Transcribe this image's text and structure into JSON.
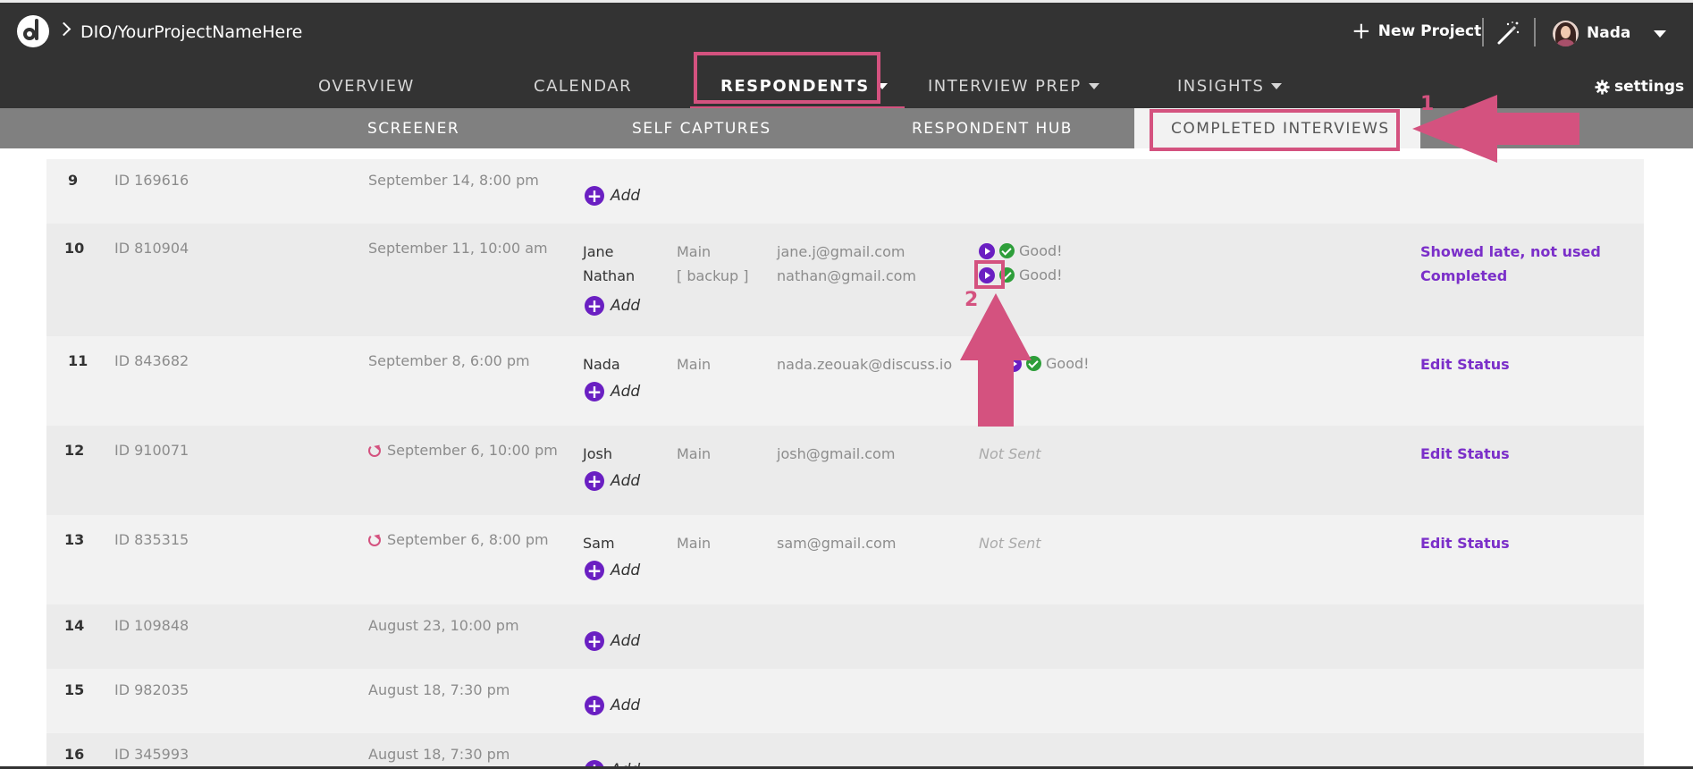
{
  "app": {
    "breadcrumb": "DIO/YourProjectNameHere",
    "new_project_label": "New Project",
    "user_name": "Nada",
    "settings_label": "settings"
  },
  "nav": {
    "tabs": [
      {
        "label": "OVERVIEW"
      },
      {
        "label": "CALENDAR"
      },
      {
        "label": "RESPONDENTS",
        "active": true
      },
      {
        "label": "INTERVIEW PREP"
      },
      {
        "label": "INSIGHTS"
      }
    ]
  },
  "subnav": {
    "tabs": [
      {
        "label": "SCREENER"
      },
      {
        "label": "SELF CAPTURES"
      },
      {
        "label": "RESPONDENT HUB"
      },
      {
        "label": "COMPLETED INTERVIEWS",
        "active": true
      }
    ]
  },
  "annotations": {
    "step1": "1",
    "step2": "2",
    "color": "#d4527f"
  },
  "colors": {
    "topbar": "#333333",
    "subbar": "#808080",
    "accent_purple": "#7b2fc9",
    "status_green": "#2e9e3a",
    "highlight_pink": "#d4527f"
  },
  "add_label": "Add",
  "rows": [
    {
      "num": "9",
      "id": "ID 169616",
      "date": "September 14, 8:00 pm"
    },
    {
      "num": "10",
      "id": "ID 810904",
      "date": "September 11, 10:00 am",
      "people": [
        {
          "name": "Jane",
          "role": "Main",
          "email": "jane.j@gmail.com",
          "status": "Good!",
          "action": "Showed late, not used"
        },
        {
          "name": "Nathan",
          "role": "[ backup ]",
          "email": "nathan@gmail.com",
          "status": "Good!",
          "action": "Completed"
        }
      ]
    },
    {
      "num": "11",
      "id": "ID 843682",
      "date": "September 8, 6:00 pm",
      "people": [
        {
          "name": "Nada",
          "role": "Main",
          "email": "nada.zeouak@discuss.io",
          "status": "Good!",
          "action": "Edit Status"
        }
      ]
    },
    {
      "num": "12",
      "id": "ID 910071",
      "date": "September 6, 10:00 pm",
      "rescheduled": true,
      "people": [
        {
          "name": "Josh",
          "role": "Main",
          "email": "josh@gmail.com",
          "status": "Not Sent",
          "action": "Edit Status"
        }
      ]
    },
    {
      "num": "13",
      "id": "ID 835315",
      "date": "September 6, 8:00 pm",
      "rescheduled": true,
      "people": [
        {
          "name": "Sam",
          "role": "Main",
          "email": "sam@gmail.com",
          "status": "Not Sent",
          "action": "Edit Status"
        }
      ]
    },
    {
      "num": "14",
      "id": "ID 109848",
      "date": "August 23, 10:00 pm"
    },
    {
      "num": "15",
      "id": "ID 982035",
      "date": "August 18, 7:30 pm"
    },
    {
      "num": "16",
      "id": "ID 345993",
      "date": "August 18, 7:30 pm"
    }
  ]
}
